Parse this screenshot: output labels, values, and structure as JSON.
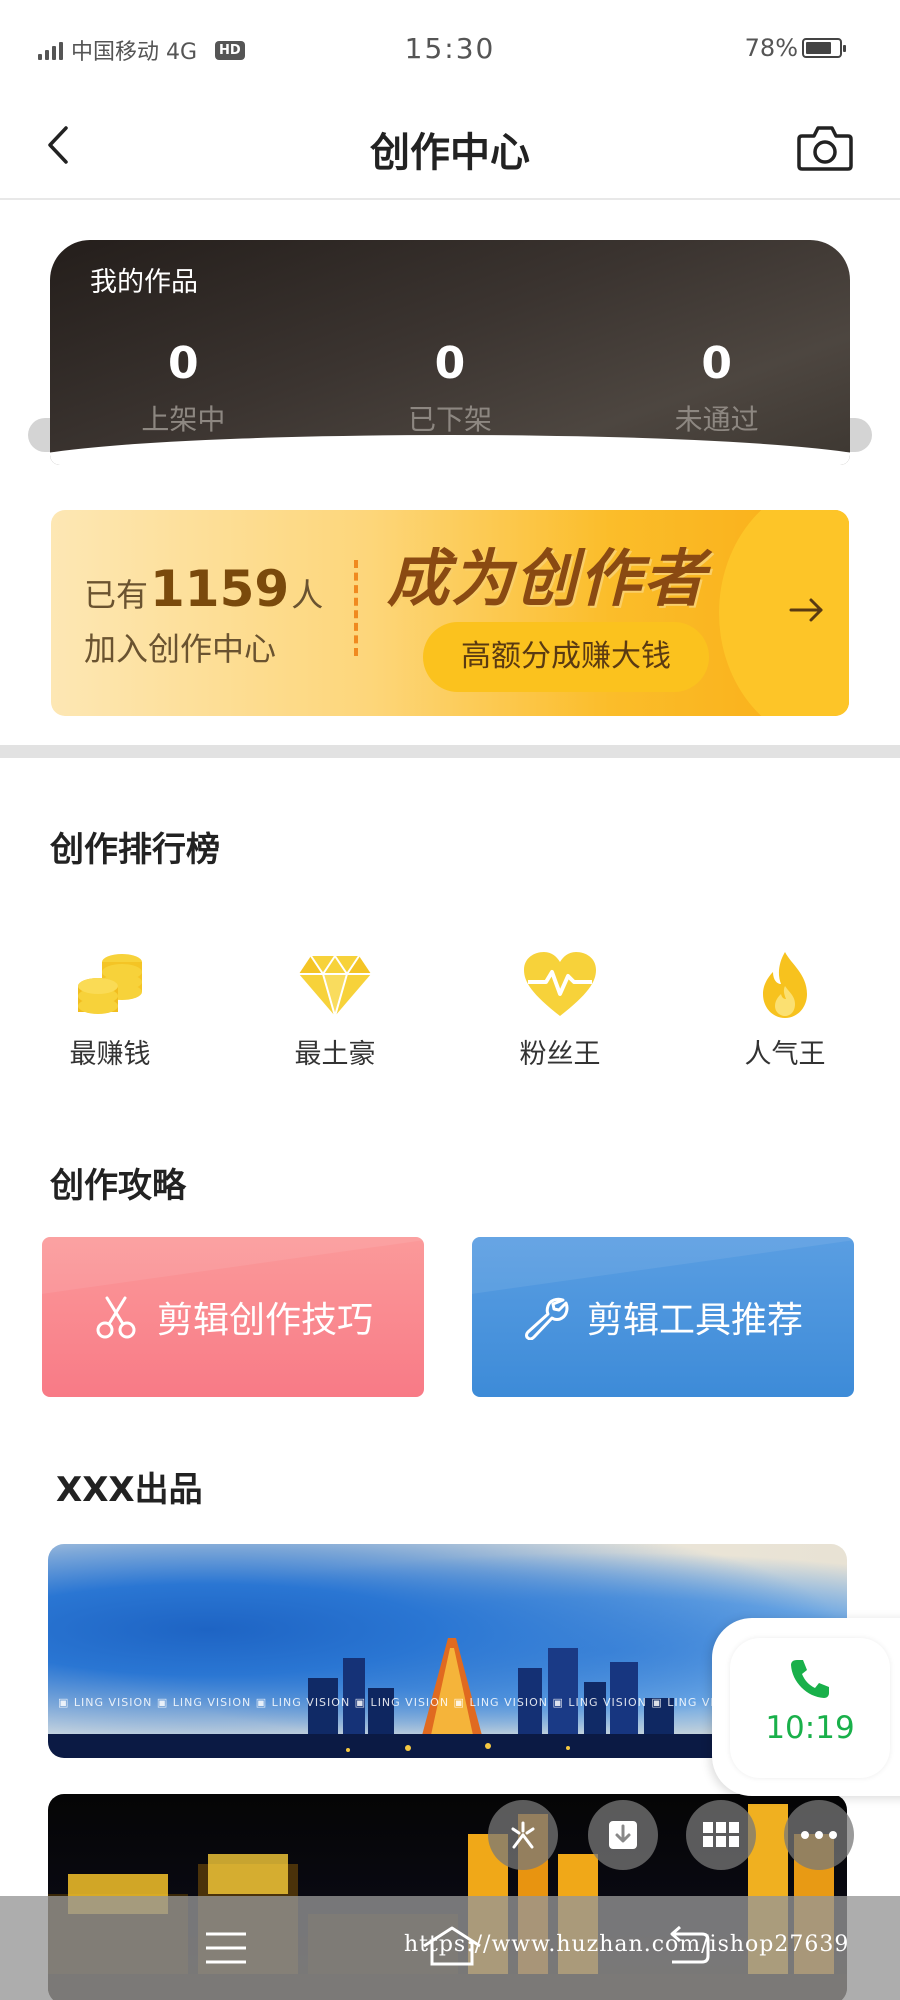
{
  "status_bar": {
    "carrier": "中国移动 4G",
    "hd": "HD",
    "time": "15:30",
    "battery": "78%",
    "battery_level": 0.78
  },
  "header": {
    "title": "创作中心",
    "back_icon": "chevron-left-icon",
    "camera_icon": "camera-icon"
  },
  "works": {
    "title": "我的作品",
    "stats": [
      {
        "value": "0",
        "label": "上架中"
      },
      {
        "value": "0",
        "label": "已下架"
      },
      {
        "value": "0",
        "label": "未通过"
      }
    ]
  },
  "creator_banner": {
    "prefix": "已有",
    "count": "1159",
    "suffix": "人",
    "line2": "加入创作中心",
    "title": "成为创作者",
    "pill": "高额分成赚大钱",
    "arrow_icon": "arrow-right-icon"
  },
  "ranking": {
    "title": "创作排行榜",
    "items": [
      {
        "label": "最赚钱",
        "icon": "coins-icon"
      },
      {
        "label": "最土豪",
        "icon": "diamond-icon"
      },
      {
        "label": "粉丝王",
        "icon": "heart-pulse-icon"
      },
      {
        "label": "人气王",
        "icon": "flame-icon"
      }
    ]
  },
  "strategy": {
    "title": "创作攻略",
    "cards": [
      {
        "label": "剪辑创作技巧",
        "icon": "scissors-icon",
        "color": "#f98a8e"
      },
      {
        "label": "剪辑工具推荐",
        "icon": "wrench-icon",
        "color": "#4a94dd"
      }
    ]
  },
  "products": {
    "title": "XXX出品",
    "watermark": "LING VISION"
  },
  "call": {
    "time": "10:19",
    "color": "#19b04a"
  },
  "nav": {
    "url": "https://www.huzhan.com/ishop27639"
  }
}
